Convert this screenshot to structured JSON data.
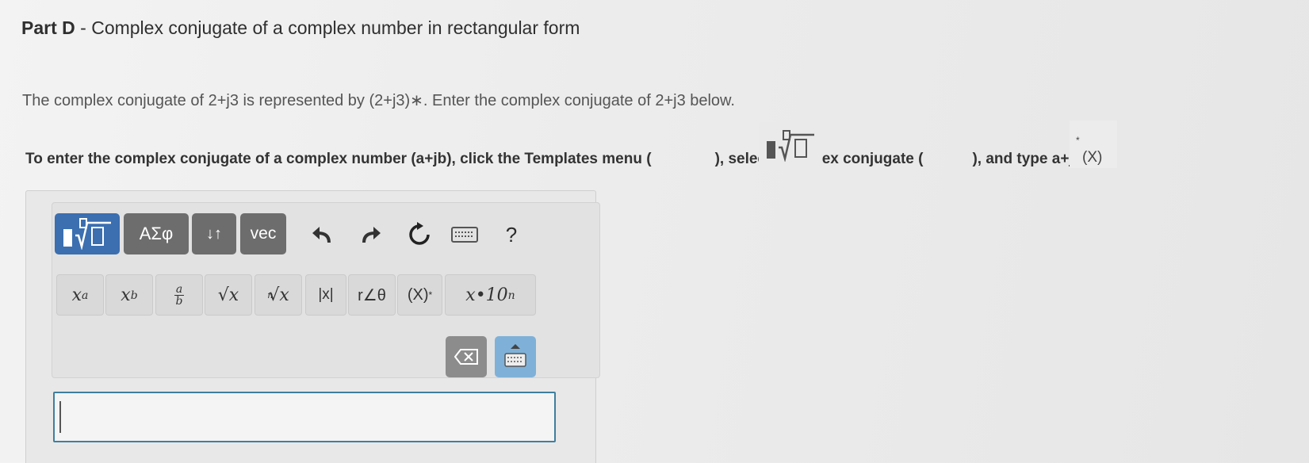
{
  "header": {
    "part_label": "Part D",
    "separator": " - ",
    "title": "Complex conjugate of a complex number in rectangular form"
  },
  "intro_text": "The complex conjugate of 2+j3 is represented by (2+j3)∗. Enter the complex conjugate of 2+j3 below.",
  "instructions": {
    "part1": "To enter the complex conjugate of a complex number (a+jb), click the Templates menu (",
    "part2": "), select Complex conjugate (",
    "part3": "), and type a+jb.",
    "conj_icon_label": "(X)",
    "conj_icon_sup": "*"
  },
  "toolbar": {
    "templates_label": "",
    "greek_label": "ΑΣφ",
    "arrows_label": "↓↑",
    "vec_label": "vec",
    "help_label": "?"
  },
  "symbols": {
    "power": "x",
    "power_sup": "a",
    "subscript": "x",
    "subscript_sub": "b",
    "frac_num": "a",
    "frac_den": "b",
    "sqrt": "√x",
    "nthroot_index": "n",
    "nthroot": "√x",
    "abs": "|x|",
    "polar": "r∠θ",
    "conj": "(X)",
    "conj_sup": "*",
    "sci": "x•10",
    "sci_sup": "n"
  },
  "answer": {
    "value": ""
  },
  "colors": {
    "accent": "#3b6fb0",
    "button_dark": "#6d6d6d",
    "field_border": "#3f7f9e"
  }
}
